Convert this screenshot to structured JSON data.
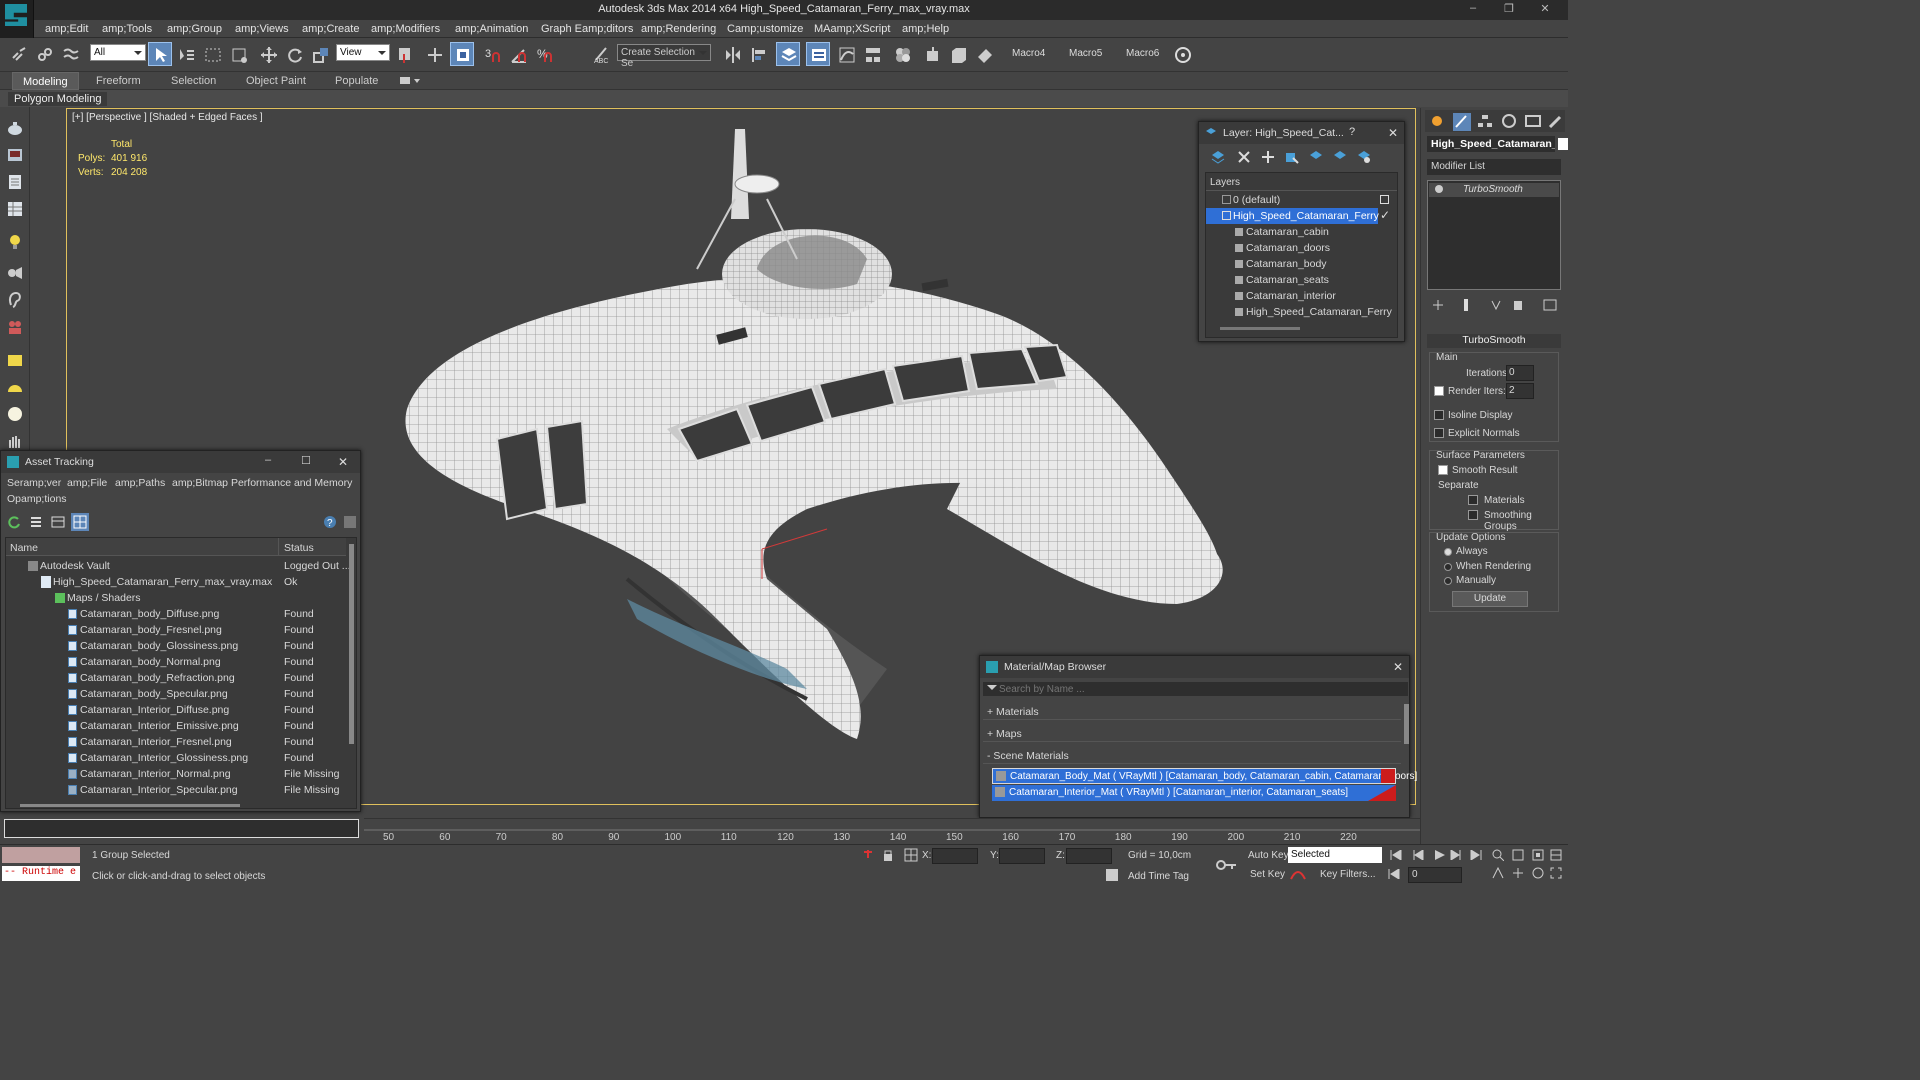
{
  "window": {
    "title": "Autodesk 3ds Max  2014 x64    High_Speed_Catamaran_Ferry_max_vray.max"
  },
  "menu": [
    "amp;Edit",
    "amp;Tools",
    "amp;Group",
    "amp;Views",
    "amp;Create",
    "amp;Modifiers",
    "amp;Animation",
    "Graph Eamp;ditors",
    "amp;Rendering",
    "Camp;ustomize",
    "MAamp;XScript",
    "amp;Help"
  ],
  "toolbar": {
    "filter_value": "All",
    "ref_coord_value": "View",
    "selection_set_placeholder": "Create Selection Se",
    "macros": [
      "Macro4",
      "Macro5",
      "Macro6"
    ]
  },
  "ribbon": {
    "tabs": [
      "Modeling",
      "Freeform",
      "Selection",
      "Object Paint",
      "Populate"
    ],
    "sub_label": "Polygon Modeling"
  },
  "viewport": {
    "label": "[+] [Perspective ] [Shaded + Edged Faces ]",
    "stats": {
      "total_label": "Total",
      "polys_label": "Polys:",
      "polys_value": "401 916",
      "verts_label": "Verts:",
      "verts_value": "204 208"
    }
  },
  "layer_dialog": {
    "title": "Layer: High_Speed_Cat...",
    "help": "?",
    "header": "Layers",
    "items": [
      "0 (default)",
      "High_Speed_Catamaran_Ferry",
      "Catamaran_cabin",
      "Catamaran_doors",
      "Catamaran_body",
      "Catamaran_seats",
      "Catamaran_interior",
      "High_Speed_Catamaran_Ferry"
    ]
  },
  "command_panel": {
    "object_name": "High_Speed_Catamaran_",
    "modifier_list": "Modifier List",
    "modifier": "TurboSmooth",
    "rollout_title": "TurboSmooth",
    "main_label": "Main",
    "iterations_label": "Iterations:",
    "iterations_value": "0",
    "render_iters_label": "Render Iters:",
    "render_iters_value": "2",
    "isoline": "Isoline Display",
    "explicit_normals": "Explicit Normals",
    "surface_params": "Surface Parameters",
    "smooth_result": "Smooth Result",
    "separate": "Separate",
    "materials": "Materials",
    "smoothing_groups": "Smoothing Groups",
    "update_options": "Update Options",
    "always": "Always",
    "when_rendering": "When Rendering",
    "manually": "Manually",
    "update_btn": "Update"
  },
  "asset_tracking": {
    "title": "Asset Tracking",
    "menu": [
      "Seramp;ver",
      "amp;File",
      "amp;Paths",
      "amp;Bitmap Performance and Memory",
      "Opamp;tions"
    ],
    "col_name": "Name",
    "col_status": "Status",
    "rows": [
      {
        "name": "Autodesk Vault",
        "status": "Logged Out ..."
      },
      {
        "name": "High_Speed_Catamaran_Ferry_max_vray.max",
        "status": "Ok"
      },
      {
        "name": "Maps / Shaders",
        "status": ""
      },
      {
        "name": "Catamaran_body_Diffuse.png",
        "status": "Found"
      },
      {
        "name": "Catamaran_body_Fresnel.png",
        "status": "Found"
      },
      {
        "name": "Catamaran_body_Glossiness.png",
        "status": "Found"
      },
      {
        "name": "Catamaran_body_Normal.png",
        "status": "Found"
      },
      {
        "name": "Catamaran_body_Refraction.png",
        "status": "Found"
      },
      {
        "name": "Catamaran_body_Specular.png",
        "status": "Found"
      },
      {
        "name": "Catamaran_Interior_Diffuse.png",
        "status": "Found"
      },
      {
        "name": "Catamaran_Interior_Emissive.png",
        "status": "Found"
      },
      {
        "name": "Catamaran_Interior_Fresnel.png",
        "status": "Found"
      },
      {
        "name": "Catamaran_Interior_Glossiness.png",
        "status": "Found"
      },
      {
        "name": "Catamaran_Interior_Normal.png",
        "status": "File Missing"
      },
      {
        "name": "Catamaran_Interior_Specular.png",
        "status": "File Missing"
      }
    ]
  },
  "material_browser": {
    "title": "Material/Map Browser",
    "search_placeholder": "Search by Name ...",
    "sections": [
      "+ Materials",
      "+ Maps",
      "- Scene Materials"
    ],
    "materials": [
      "Catamaran_Body_Mat  ( VRayMtl ) [Catamaran_body, Catamaran_cabin, Catamaran_doors]",
      "Catamaran_Interior_Mat  ( VRayMtl ) [Catamaran_interior, Catamaran_seats]"
    ]
  },
  "timeline": {
    "ticks": [
      "50",
      "60",
      "70",
      "80",
      "90",
      "100",
      "110",
      "120",
      "130",
      "140",
      "150",
      "160",
      "170",
      "180",
      "190",
      "200",
      "210",
      "220"
    ]
  },
  "status": {
    "runtime": "-- Runtime e",
    "selection": "1 Group Selected",
    "prompt": "Click or click-and-drag to select objects",
    "x_label": "X:",
    "y_label": "Y:",
    "z_label": "Z:",
    "grid": "Grid = 10,0cm",
    "add_time_tag": "Add Time Tag",
    "auto_key": "Auto Key",
    "set_key": "Set Key",
    "selected": "Selected",
    "key_filters": "Key Filters...",
    "frame": "0"
  },
  "colors": {
    "accent": "#2f6fd6",
    "viewport_border": "#e0c05c",
    "stat_text": "#ffe86b",
    "missing": "#cc1c1c"
  }
}
